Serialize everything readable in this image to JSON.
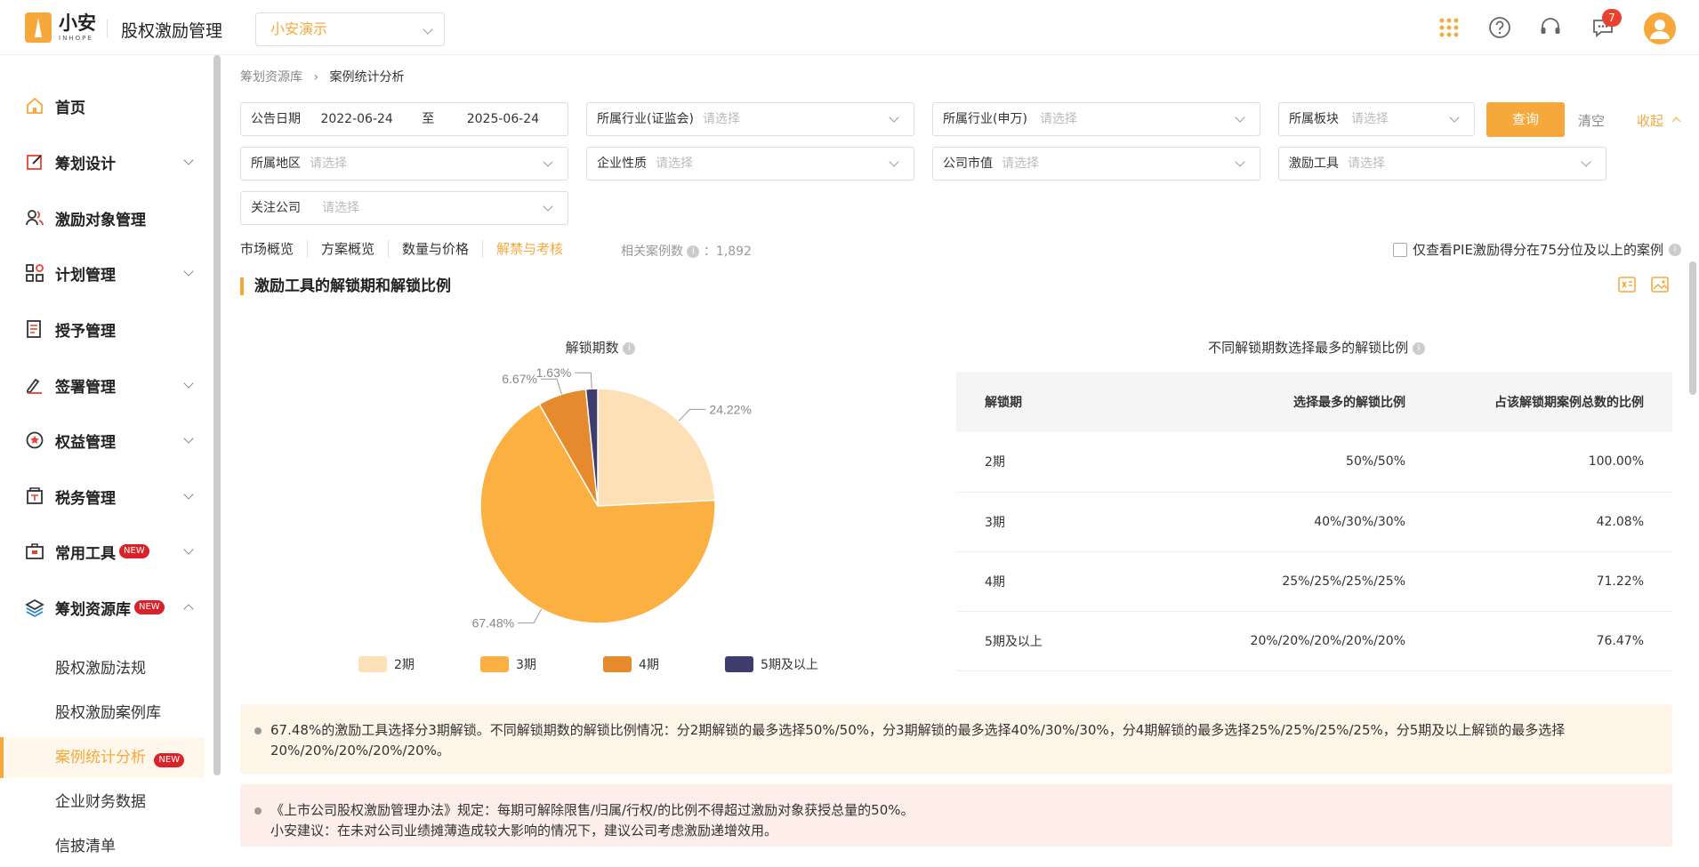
{
  "header": {
    "logo_cn": "小安",
    "logo_en": "INHOPE",
    "app_title": "股权激励管理",
    "company": "小安演示",
    "notification_count": "7"
  },
  "sidebar": {
    "items": [
      {
        "label": "首页",
        "icon": "home-icon"
      },
      {
        "label": "筹划设计",
        "icon": "edit-icon"
      },
      {
        "label": "激励对象管理",
        "icon": "users-icon"
      },
      {
        "label": "计划管理",
        "icon": "grid-icon"
      },
      {
        "label": "授予管理",
        "icon": "document-icon"
      },
      {
        "label": "签署管理",
        "icon": "sign-icon"
      },
      {
        "label": "权益管理",
        "icon": "badge-icon"
      },
      {
        "label": "税务管理",
        "icon": "tax-icon"
      },
      {
        "label": "常用工具",
        "icon": "toolbox-icon",
        "badge": "NEW"
      },
      {
        "label": "筹划资源库",
        "icon": "layers-icon",
        "badge": "NEW"
      }
    ],
    "sub_items": [
      {
        "label": "股权激励法规"
      },
      {
        "label": "股权激励案例库"
      },
      {
        "label": "案例统计分析",
        "badge": "NEW"
      },
      {
        "label": "企业财务数据"
      },
      {
        "label": "信披清单"
      }
    ]
  },
  "breadcrumb": {
    "parent": "筹划资源库",
    "current": "案例统计分析"
  },
  "filters": {
    "date_label": "公告日期",
    "date_from": "2022-06-24",
    "date_sep": "至",
    "date_to": "2025-06-24",
    "industry_csrc": "所属行业(证监会)",
    "industry_sw": "所属行业(申万)",
    "board": "所属板块",
    "region": "所属地区",
    "nature": "企业性质",
    "market_cap": "公司市值",
    "tool": "激励工具",
    "follow": "关注公司",
    "placeholder": "请选择",
    "query": "查询",
    "clear": "清空",
    "collapse": "收起"
  },
  "tabs": [
    "市场概览",
    "方案概览",
    "数量与价格",
    "解禁与考核"
  ],
  "case_count_label": "相关案例数",
  "case_count": "：1,892",
  "pie_filter_label": "仅查看PIE激励得分在75分位及以上的案例",
  "section_title": "激励工具的解锁期和解锁比例",
  "pie_title": "解锁期数",
  "table_title": "不同解锁期数选择最多的解锁比例",
  "chart_data": {
    "type": "pie",
    "categories": [
      "2期",
      "3期",
      "4期",
      "5期及以上"
    ],
    "values": [
      24.22,
      67.48,
      6.67,
      1.63
    ],
    "labels": [
      "24.22%",
      "67.48%",
      "6.67%",
      "1.63%"
    ],
    "colors": [
      "#fde0b6",
      "#fbb041",
      "#e68a2e",
      "#3f3d6e"
    ]
  },
  "table": {
    "headers": [
      "解锁期",
      "选择最多的解锁比例",
      "占该解锁期案例总数的比例"
    ],
    "rows": [
      [
        "2期",
        "50%/50%",
        "100.00%"
      ],
      [
        "3期",
        "40%/30%/30%",
        "42.08%"
      ],
      [
        "4期",
        "25%/25%/25%/25%",
        "71.22%"
      ],
      [
        "5期及以上",
        "20%/20%/20%/20%/20%",
        "76.47%"
      ]
    ]
  },
  "notes": [
    "67.48%的激励工具选择分3期解锁。不同解锁期数的解锁比例情况：分2期解锁的最多选择50%/50%，分3期解锁的最多选择40%/30%/30%，分4期解锁的最多选择25%/25%/25%/25%，分5期及以上解锁的最多选择20%/20%/20%/20%/20%。",
    "《上市公司股权激励管理办法》规定：每期可解除限售/归属/行权/的比例不得超过激励对象获授总量的50%。",
    "小安建议：在未对公司业绩摊薄造成较大影响的情况下，建议公司考虑激励递增效用。"
  ]
}
